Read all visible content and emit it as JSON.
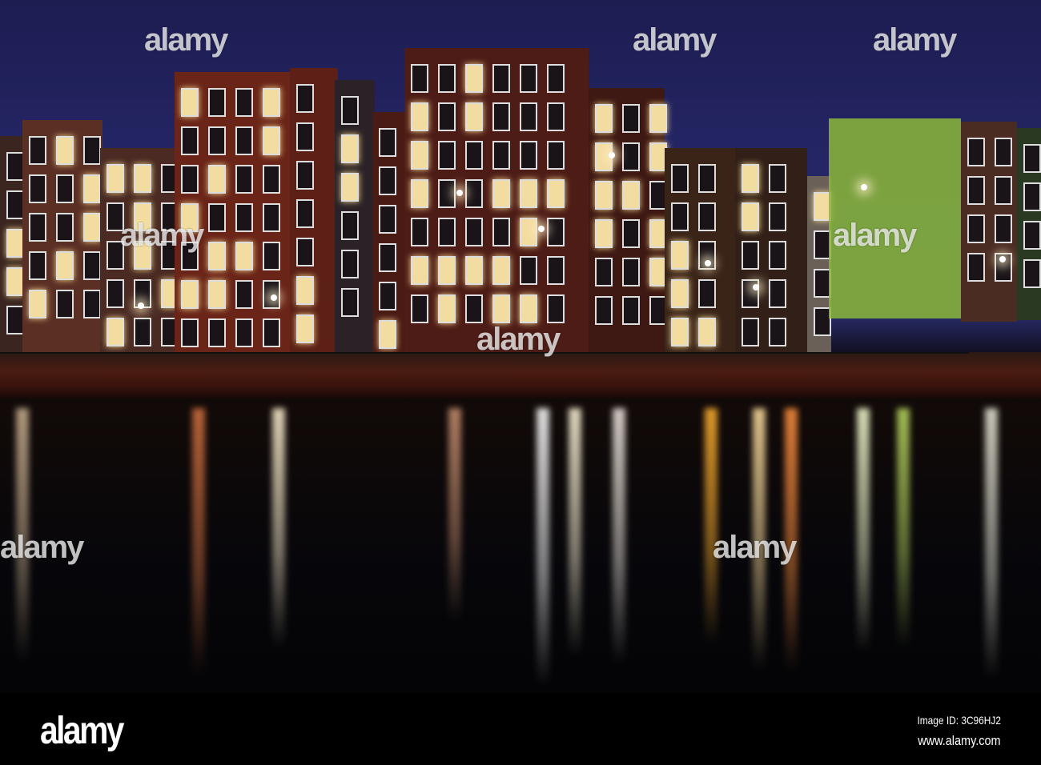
{
  "watermark": {
    "text": "alamy"
  },
  "footer": {
    "logo": "alamy",
    "image_id": "Image ID: 3C96HJ2",
    "url": "www.alamy.com"
  },
  "colors": {
    "sky": "#26286a",
    "brick": "#5a2418",
    "window_lit": "#f3dca0",
    "scaffold": "#9bc23a",
    "water": "#06060a"
  }
}
